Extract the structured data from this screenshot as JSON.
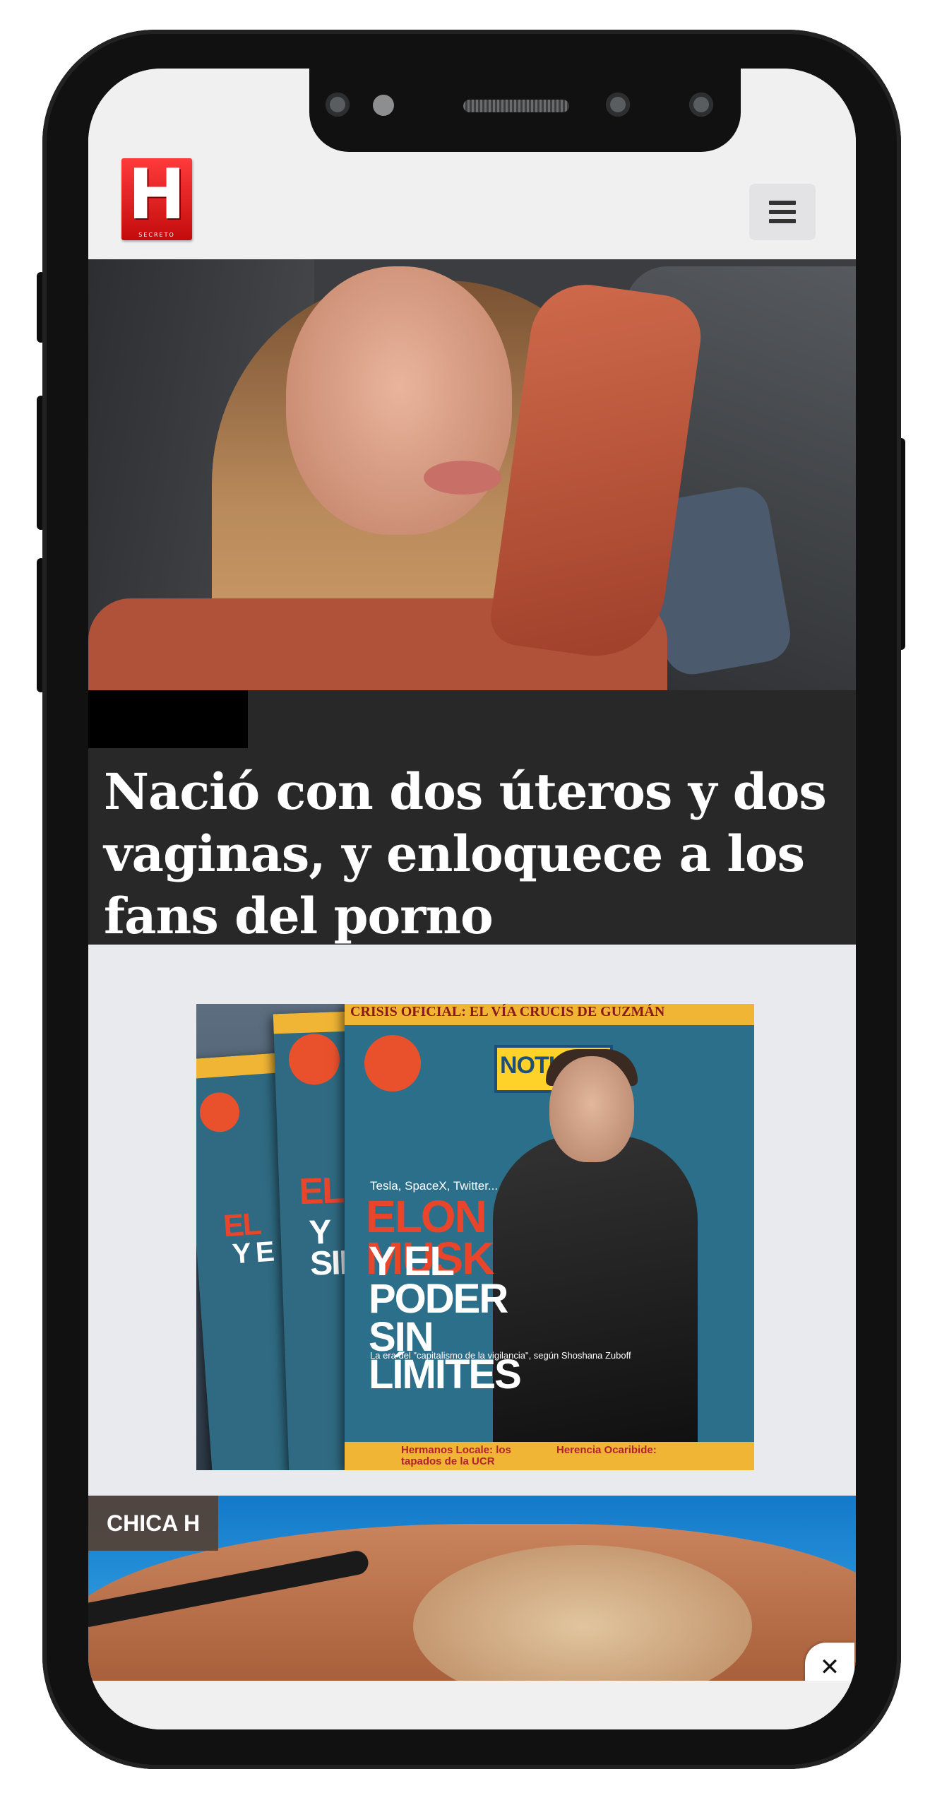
{
  "header": {
    "logo_letter": "H",
    "logo_sub": "SECRETO",
    "menu_icon": "hamburger-menu-icon"
  },
  "hero": {
    "category": "",
    "headline": "Nació con dos úteros y dos vaginas, y enloquece a los fans del porno"
  },
  "magazine_ad": {
    "top_band": "CRISIS OFICIAL: EL VÍA CRUCIS DE GUZMÁN",
    "masthead": "NOTICIAS",
    "kicker": "Tesla, SpaceX, Twitter...",
    "headline_red": "ELON MUSK",
    "headline_white": "Y EL PODER SIN LÍMITES",
    "subline": "La era del \"capitalismo de la vigilancia\", según Shoshana Zuboff",
    "strip_left": "Hermanos Locale: los tapados de la UCR",
    "strip_right": "Herencia Ocaribide:"
  },
  "promo": {
    "label": "CHICA H",
    "close": "✕"
  },
  "colors": {
    "brand_red": "#d91414",
    "headline_bg": "#282828",
    "screen_bg": "#f0f0f1"
  }
}
